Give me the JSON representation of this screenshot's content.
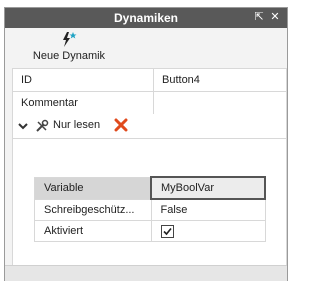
{
  "window": {
    "title": "Dynamiken",
    "pin_glyph": "⇱",
    "close_glyph": "✕"
  },
  "toolbar": {
    "new_label": "Neue Dynamik"
  },
  "properties": {
    "id_label": "ID",
    "id_value": "Button4",
    "comment_label": "Kommentar",
    "comment_value": ""
  },
  "dynamic": {
    "mode_label": "Nur lesen"
  },
  "grid": {
    "rows": [
      {
        "key": "Variable",
        "value": "MyBoolVar"
      },
      {
        "key": "Schreibgeschütz...",
        "value": "False"
      },
      {
        "key": "Aktiviert",
        "checked": true
      }
    ]
  },
  "colors": {
    "accent_star": "#1fa3c4",
    "delete_red": "#e04a1c"
  },
  "icons": [
    "lightning-star-icon",
    "chevron-down-icon",
    "tools-icon",
    "delete-x-icon",
    "checkbox-checked-icon"
  ]
}
